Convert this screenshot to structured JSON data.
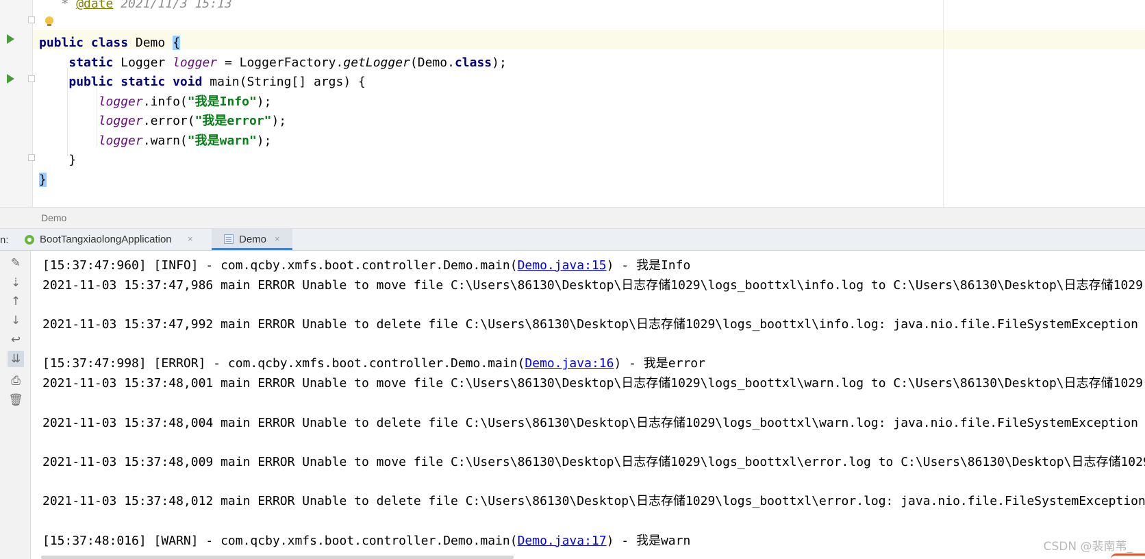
{
  "editor": {
    "code_lines": [
      [
        {
          "t": "   * ",
          "c": "cmt"
        },
        {
          "t": "@date",
          "c": "anno"
        },
        {
          "t": " 2021/11/3 15:13",
          "c": "cmt"
        }
      ],
      [
        {
          "t": "",
          "c": ""
        }
      ],
      [
        {
          "t": "public class",
          "c": "k"
        },
        {
          "t": " Demo ",
          "c": ""
        },
        {
          "t": "{",
          "c": "brace-hl"
        }
      ],
      [
        {
          "t": "    ",
          "c": ""
        },
        {
          "t": "static",
          "c": "k"
        },
        {
          "t": " Logger ",
          "c": ""
        },
        {
          "t": "logger",
          "c": "fld"
        },
        {
          "t": " = LoggerFactory.",
          "c": ""
        },
        {
          "t": "getLogger",
          "c": "mth"
        },
        {
          "t": "(Demo.",
          "c": ""
        },
        {
          "t": "class",
          "c": "k"
        },
        {
          "t": ");",
          "c": ""
        }
      ],
      [
        {
          "t": "    ",
          "c": ""
        },
        {
          "t": "public static void",
          "c": "k"
        },
        {
          "t": " main(String[] args) {",
          "c": ""
        }
      ],
      [
        {
          "t": "        ",
          "c": ""
        },
        {
          "t": "logger",
          "c": "fld"
        },
        {
          "t": ".info(",
          "c": ""
        },
        {
          "t": "\"我是Info\"",
          "c": "str"
        },
        {
          "t": ");",
          "c": ""
        }
      ],
      [
        {
          "t": "        ",
          "c": ""
        },
        {
          "t": "logger",
          "c": "fld"
        },
        {
          "t": ".error(",
          "c": ""
        },
        {
          "t": "\"我是error\"",
          "c": "str"
        },
        {
          "t": ");",
          "c": ""
        }
      ],
      [
        {
          "t": "        ",
          "c": ""
        },
        {
          "t": "logger",
          "c": "fld"
        },
        {
          "t": ".warn(",
          "c": ""
        },
        {
          "t": "\"我是warn\"",
          "c": "str"
        },
        {
          "t": ");",
          "c": ""
        }
      ],
      [
        {
          "t": "    }",
          "c": ""
        }
      ],
      [
        {
          "t": "}",
          "c": "brace-hl"
        }
      ]
    ]
  },
  "breadcrumb": {
    "label": "Demo"
  },
  "run_panel": {
    "label": "n:",
    "tabs": [
      {
        "label": "BootTangxiaolongApplication",
        "close": "×",
        "icon": "spring-boot-icon",
        "active": false
      },
      {
        "label": "Demo",
        "close": "×",
        "icon": "java-class-icon",
        "active": true
      }
    ]
  },
  "console": {
    "toolbar": [
      {
        "name": "clear-all-icon",
        "glyph": "✎"
      },
      {
        "name": "scroll-to-end-icon",
        "glyph": "⇣"
      },
      {
        "name": "up-arrow-icon",
        "glyph": "↑"
      },
      {
        "name": "down-arrow-icon",
        "glyph": "↓"
      },
      {
        "name": "soft-wrap-icon",
        "glyph": "↩"
      },
      {
        "name": "scroll-to-end-toggle-icon",
        "glyph": "⇊"
      },
      {
        "name": "print-icon",
        "glyph": "⎙"
      },
      {
        "name": "trash-icon",
        "glyph": "🗑"
      }
    ],
    "lines": [
      [
        {
          "t": "[15:37:47:960] [INFO] - com.qcby.xmfs.boot.controller.Demo.main(",
          "c": ""
        },
        {
          "t": "Demo.java:15",
          "c": "lnk"
        },
        {
          "t": ") - 我是Info",
          "c": ""
        }
      ],
      [
        {
          "t": "2021-11-03 15:37:47,986 main ERROR Unable to move file C:\\Users\\86130\\Desktop\\日志存储1029\\logs_boottxl\\info.log to C:\\Users\\86130\\Desktop\\日志存储1029",
          "c": ""
        }
      ],
      [
        {
          "t": "",
          "c": ""
        }
      ],
      [
        {
          "t": "2021-11-03 15:37:47,992 main ERROR Unable to delete file C:\\Users\\86130\\Desktop\\日志存储1029\\logs_boottxl\\info.log: java.nio.file.FileSystemException",
          "c": ""
        }
      ],
      [
        {
          "t": "",
          "c": ""
        }
      ],
      [
        {
          "t": "[15:37:47:998] [ERROR] - com.qcby.xmfs.boot.controller.Demo.main(",
          "c": ""
        },
        {
          "t": "Demo.java:16",
          "c": "lnk"
        },
        {
          "t": ") - 我是error",
          "c": ""
        }
      ],
      [
        {
          "t": "2021-11-03 15:37:48,001 main ERROR Unable to move file C:\\Users\\86130\\Desktop\\日志存储1029\\logs_boottxl\\warn.log to C:\\Users\\86130\\Desktop\\日志存储1029",
          "c": ""
        }
      ],
      [
        {
          "t": "",
          "c": ""
        }
      ],
      [
        {
          "t": "2021-11-03 15:37:48,004 main ERROR Unable to delete file C:\\Users\\86130\\Desktop\\日志存储1029\\logs_boottxl\\warn.log: java.nio.file.FileSystemException",
          "c": ""
        }
      ],
      [
        {
          "t": "",
          "c": ""
        }
      ],
      [
        {
          "t": "2021-11-03 15:37:48,009 main ERROR Unable to move file C:\\Users\\86130\\Desktop\\日志存储1029\\logs_boottxl\\error.log to C:\\Users\\86130\\Desktop\\日志存储1029",
          "c": ""
        }
      ],
      [
        {
          "t": "",
          "c": ""
        }
      ],
      [
        {
          "t": "2021-11-03 15:37:48,012 main ERROR Unable to delete file C:\\Users\\86130\\Desktop\\日志存储1029\\logs_boottxl\\error.log: java.nio.file.FileSystemException",
          "c": ""
        }
      ],
      [
        {
          "t": "",
          "c": ""
        }
      ],
      [
        {
          "t": "[15:37:48:016] [WARN] - com.qcby.xmfs.boot.controller.Demo.main(",
          "c": ""
        },
        {
          "t": "Demo.java:17",
          "c": "lnk"
        },
        {
          "t": ") - 我是warn",
          "c": ""
        }
      ]
    ]
  },
  "watermark": "CSDN @裴南苇_",
  "colors": {
    "keyword": "#000080",
    "field": "#660e7a",
    "string": "#067d17",
    "link": "#0000ee",
    "run_marker": "#4a9c3b",
    "tab_underline": "#4083c9"
  }
}
